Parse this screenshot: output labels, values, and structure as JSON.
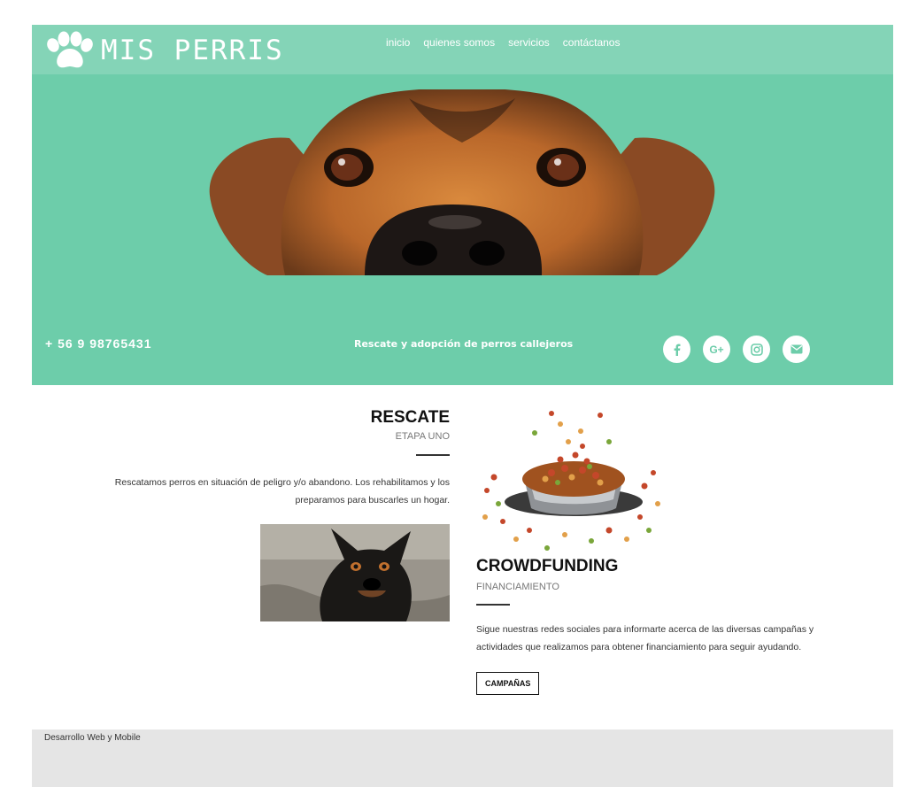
{
  "header": {
    "logo_text": "MIS PERRIS",
    "nav": [
      "inicio",
      "quienes somos",
      "servicios",
      "contáctanos"
    ]
  },
  "hero": {
    "phone": "+ 56 9 98765431",
    "tagline": "Rescate y adopción de perros callejeros",
    "social_icons": [
      "facebook-icon",
      "google-plus-icon",
      "instagram-icon",
      "email-icon"
    ],
    "gplus_label": "G+"
  },
  "rescate": {
    "title": "RESCATE",
    "subtitle": "ETAPA UNO",
    "text": "Rescatamos perros en situación de peligro y/o abandono. Los rehabilitamos y los preparamos para buscarles un hogar."
  },
  "crowdfunding": {
    "title": "CROWDFUNDING",
    "subtitle": "FINANCIAMIENTO",
    "text": "Sigue nuestras redes sociales para informarte acerca de las diversas campañas y actividades que realizamos para obtener financiamiento para seguir ayudando.",
    "button": "CAMPAÑAS"
  },
  "footer": {
    "text": "Desarrollo Web y Mobile"
  },
  "colors": {
    "hero_green": "#6dcdaa",
    "topbar_green": "#84d4b7",
    "footer_gray": "#e5e5e5"
  }
}
